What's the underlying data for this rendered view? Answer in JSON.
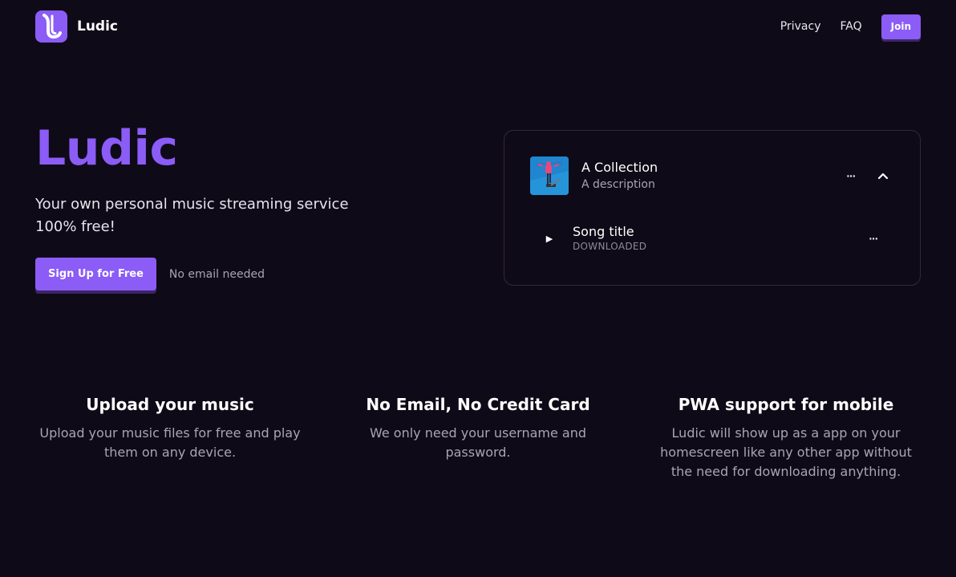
{
  "header": {
    "brand_name": "Ludic",
    "nav": {
      "privacy": "Privacy",
      "faq": "FAQ",
      "join": "Join"
    }
  },
  "hero": {
    "title": "Ludic",
    "subtitle": "Your own personal music streaming service 100% free!",
    "cta_label": "Sign Up for Free",
    "cta_note": "No email needed"
  },
  "card": {
    "collection": {
      "title": "A Collection",
      "description": "A description",
      "more_label": "···",
      "collapse_icon": "chevron-up-icon"
    },
    "song": {
      "play_icon": "play-icon",
      "play_glyph": "▶",
      "title": "Song title",
      "status": "DOWNLOADED",
      "more_label": "···"
    }
  },
  "features": [
    {
      "title": "Upload your music",
      "description": "Upload your music files for free and play them on any device."
    },
    {
      "title": "No Email, No Credit Card",
      "description": "We only need your username and password."
    },
    {
      "title": "PWA support for mobile",
      "description": "Ludic will show up as a app on your homescreen like any other app without the need for downloading anything."
    }
  ],
  "colors": {
    "accent": "#8b5cf6",
    "background": "#0f0a17",
    "muted_text": "#a9a4b4"
  }
}
